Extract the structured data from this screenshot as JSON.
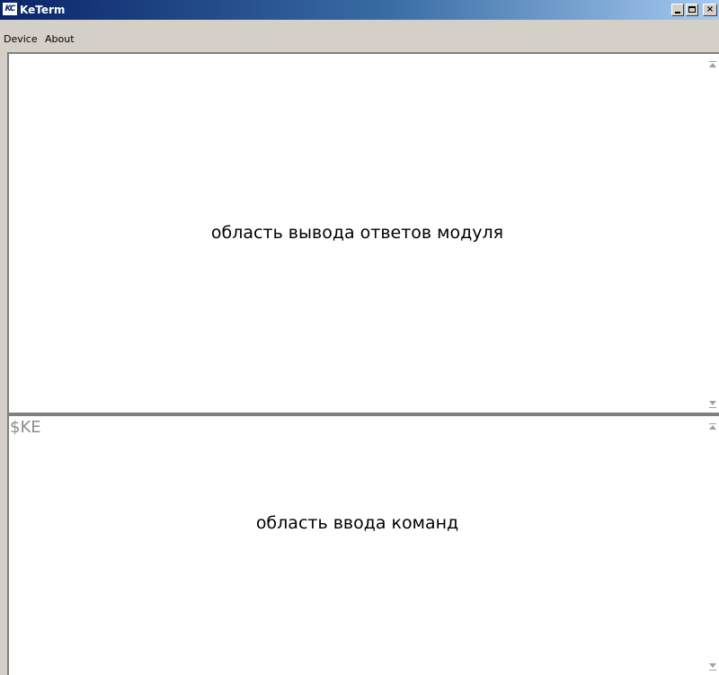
{
  "window": {
    "title": "KeTerm",
    "icon_text": "KC",
    "controls": {
      "minimize": "minimize-icon",
      "maximize": "maximize-icon",
      "close_label": "×"
    }
  },
  "menu": {
    "items": [
      {
        "label": "Device"
      },
      {
        "label": "About"
      }
    ]
  },
  "output_pane": {
    "caption": "область вывода ответов модуля"
  },
  "input_pane": {
    "prompt": "$KE",
    "caption": "область ввода команд"
  },
  "colors": {
    "title_gradient_start": "#0a246a",
    "title_gradient_end": "#a6caf0",
    "chrome": "#d4d0c8",
    "pane_background": "#ffffff",
    "prompt_text": "#8c8c8c"
  }
}
